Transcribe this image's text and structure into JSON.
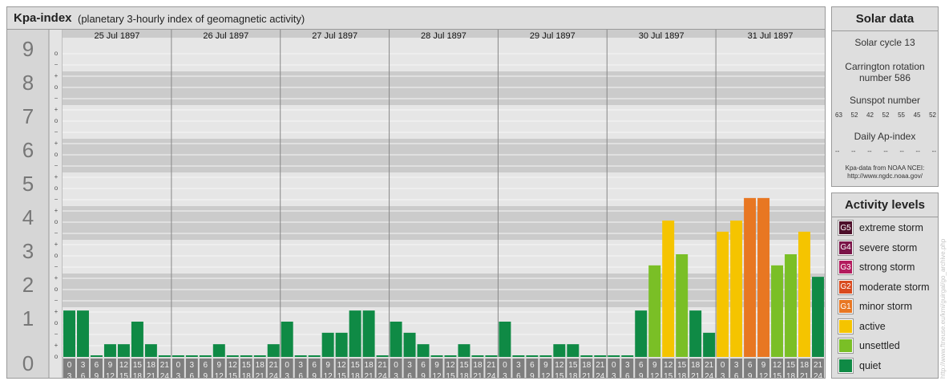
{
  "header": {
    "title": "Kpa-index",
    "subtitle": "(planetary 3-hourly index of geomagnetic activity)"
  },
  "solar": {
    "title": "Solar data",
    "cycle": "Solar cycle 13",
    "carrington_line1": "Carrington rotation",
    "carrington_line2": "number 586",
    "sunspot_label": "Sunspot number",
    "sunspots": [
      "63",
      "52",
      "42",
      "52",
      "55",
      "45",
      "52"
    ],
    "dailyap_label": "Daily Ap-index",
    "dailyap": [
      "--",
      "--",
      "--",
      "--",
      "--",
      "--",
      "--"
    ],
    "credit_line1": "Kpa-data from NOAA NCEI:",
    "credit_line2": "http://www.ngdc.noaa.gov/"
  },
  "legend": {
    "title": "Activity levels",
    "items": [
      {
        "code": "G5",
        "label": "extreme storm",
        "color": "#4d0f2a"
      },
      {
        "code": "G4",
        "label": "severe storm",
        "color": "#7a1448"
      },
      {
        "code": "G3",
        "label": "strong storm",
        "color": "#b31b5e"
      },
      {
        "code": "G2",
        "label": "moderate storm",
        "color": "#d94a1e"
      },
      {
        "code": "G1",
        "label": "minor storm",
        "color": "#e87722"
      },
      {
        "code": "",
        "label": "active",
        "color": "#f5c400"
      },
      {
        "code": "",
        "label": "unsettled",
        "color": "#7abf26"
      },
      {
        "code": "",
        "label": "quiet",
        "color": "#0f8a45"
      }
    ]
  },
  "watermark": "http://www.ftneuse.eu/kmi/guirgal/go_archive.php",
  "chart_data": {
    "type": "bar",
    "ylim": [
      0,
      9
    ],
    "y_ticks": [
      "0",
      "1",
      "2",
      "3",
      "4",
      "5",
      "6",
      "7",
      "8",
      "9"
    ],
    "y_minor_labels": [
      "o",
      "+",
      "−",
      "o",
      "+",
      "−",
      "o",
      "+",
      "−",
      "o",
      "+",
      "−",
      "o",
      "+",
      "−",
      "o",
      "+",
      "−",
      "o",
      "+",
      "−",
      "o",
      "+",
      "−",
      "o",
      "+",
      "−",
      "o"
    ],
    "days": [
      "25 Jul 1897",
      "26 Jul 1897",
      "27 Jul 1897",
      "28 Jul 1897",
      "29 Jul 1897",
      "30 Jul 1897",
      "31 Jul 1897"
    ],
    "interval_top": [
      "0",
      "3",
      "6",
      "9",
      "12",
      "15",
      "18",
      "21"
    ],
    "interval_bottom": [
      "3",
      "6",
      "9",
      "12",
      "15",
      "18",
      "21",
      "24"
    ],
    "colors": {
      "quiet": "#0f8a45",
      "unsettled": "#7abf26",
      "active": "#f5c400",
      "minor": "#e87722"
    },
    "values": [
      [
        1.33,
        1.33,
        0,
        0.33,
        0.33,
        1,
        0.33,
        0
      ],
      [
        0,
        0,
        0,
        0.33,
        0,
        0,
        0,
        0.33
      ],
      [
        1,
        0,
        0,
        0.67,
        0.67,
        1.33,
        1.33,
        0
      ],
      [
        1,
        0.67,
        0.33,
        0,
        0,
        0.33,
        0,
        0
      ],
      [
        1,
        0,
        0,
        0,
        0.33,
        0.33,
        0,
        0
      ],
      [
        0,
        0,
        1.33,
        2.67,
        4,
        3,
        1.33,
        0.67
      ],
      [
        3.67,
        4,
        4.67,
        4.67,
        2.67,
        3,
        3.67,
        2.33
      ]
    ]
  }
}
